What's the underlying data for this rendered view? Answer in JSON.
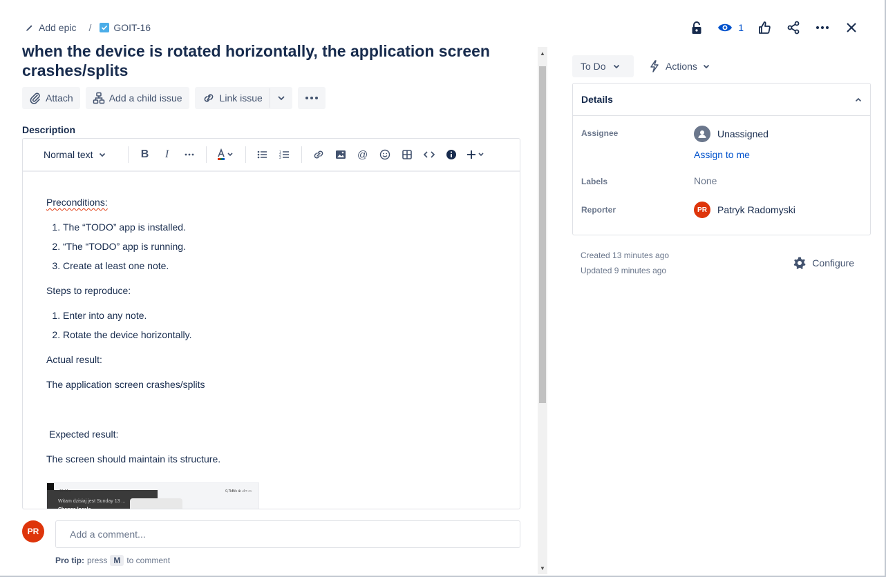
{
  "breadcrumb": {
    "epic_label": "Add epic",
    "separator": "/",
    "issue_key": "GOIT-16"
  },
  "header": {
    "watch_count": "1"
  },
  "issue": {
    "title": "when the device is rotated horizontally, the application screen crashes/splits"
  },
  "toolbar": {
    "attach": "Attach",
    "add_child": "Add a child issue",
    "link_issue": "Link issue"
  },
  "description": {
    "label": "Description",
    "text_style": "Normal text",
    "preconditions_heading": "Preconditions:",
    "preconditions": [
      "The “TODO” app is installed.",
      "“The “TODO” app is running.",
      "Create at least one note."
    ],
    "steps_heading": "Steps to reproduce:",
    "steps": [
      "Enter into any note.",
      "Rotate the device horizontally."
    ],
    "actual_heading": "Actual result:",
    "actual_text": "The application screen crashes/splits",
    "expected_heading": "Expected result:",
    "expected_text": "The screen should maintain its structure.",
    "screenshot": {
      "time": "13:44 ●",
      "status": "0,7kB/s ⊕ .ıl ≈ ▭",
      "line1": "Witam dzisiaj jest Sunday 13 ...",
      "line2": "Change locale"
    }
  },
  "comment": {
    "avatar_initials": "PR",
    "placeholder": "Add a comment...",
    "protip_prefix": "Pro tip:",
    "protip_press": "press",
    "protip_key": "M",
    "protip_suffix": "to comment"
  },
  "sidebar": {
    "status": "To Do",
    "actions": "Actions",
    "details_title": "Details",
    "assignee_label": "Assignee",
    "assignee_value": "Unassigned",
    "assign_to_me": "Assign to me",
    "labels_label": "Labels",
    "labels_value": "None",
    "reporter_label": "Reporter",
    "reporter_initials": "PR",
    "reporter_name": "Patryk Radomyski",
    "created": "Created 13 minutes ago",
    "updated": "Updated 9 minutes ago",
    "configure": "Configure"
  },
  "colors": {
    "accent": "#0052cc",
    "avatar": "#de350b",
    "text": "#172b4d",
    "muted": "#6b778c"
  }
}
